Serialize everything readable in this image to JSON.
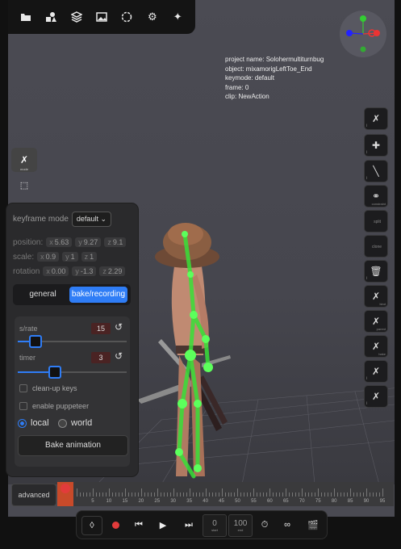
{
  "top_toolbar": {
    "icons": [
      "folder-icon",
      "shapes-icon",
      "layers-icon",
      "image-icon",
      "aperture-icon",
      "gear-icon",
      "sparkle-icon"
    ]
  },
  "info": {
    "project": "project name: Solohermultiturnbug",
    "object": "object: mixamorigLeftToe_End",
    "keymode": "keymode: default",
    "frame": "frame: 0",
    "clip": "clip: NewAction"
  },
  "left_tools": [
    {
      "name": "rig-mode-tool",
      "label": "mode"
    },
    {
      "name": "select-box-tool",
      "label": ""
    }
  ],
  "right_tools": [
    {
      "name": "rig-tool",
      "label": ""
    },
    {
      "name": "move-tool",
      "label": ""
    },
    {
      "name": "draw-tool",
      "label": ""
    },
    {
      "name": "constraint-tool",
      "label": "constraint"
    },
    {
      "name": "split-tool",
      "label": "split"
    },
    {
      "name": "clone-tool",
      "label": "clone"
    },
    {
      "name": "delete-tool",
      "label": ""
    },
    {
      "name": "bind-tool",
      "label": "bind"
    },
    {
      "name": "parent-tool",
      "label": "parent"
    },
    {
      "name": "bake-tool",
      "label": "bake"
    },
    {
      "name": "ik-tool",
      "label": ""
    },
    {
      "name": "retarget-tool",
      "label": ""
    }
  ],
  "panel": {
    "keyframe_mode_label": "keyframe mode",
    "keyframe_mode_value": "default",
    "position_label": "position:",
    "position": {
      "x": "5.63",
      "y": "9.27",
      "z": "9.1"
    },
    "scale_label": "scale:",
    "scale": {
      "x": "0.9",
      "y": "1",
      "z": "1"
    },
    "rotation_label": "rotation",
    "rotation": {
      "x": "0.00",
      "y": "-1.3",
      "z": "2.29"
    },
    "tabs": {
      "general": "general",
      "bake": "bake/recording",
      "active": "bake"
    },
    "rate_label": "s/rate",
    "rate_value": "15",
    "rate_fraction": 0.15,
    "timer_label": "timer",
    "timer_value": "3",
    "timer_fraction": 0.33,
    "cleanup_label": "clean-up keys",
    "puppeteer_label": "enable puppeteer",
    "local_label": "local",
    "world_label": "world",
    "space_selected": "local",
    "bake_button": "Bake animation"
  },
  "timeline": {
    "advanced_label": "advanced",
    "frame_labels": [
      "5",
      "10",
      "15",
      "20",
      "25",
      "30",
      "35",
      "40",
      "45",
      "50",
      "55",
      "60",
      "65",
      "70",
      "75",
      "80",
      "85",
      "90",
      "95"
    ]
  },
  "transport": {
    "start_value": "0",
    "start_label": "start",
    "end_value": "100",
    "end_label": "end"
  },
  "colors": {
    "accent": "#2f7df6",
    "record": "#e23b3b",
    "bone": "#38e038"
  }
}
